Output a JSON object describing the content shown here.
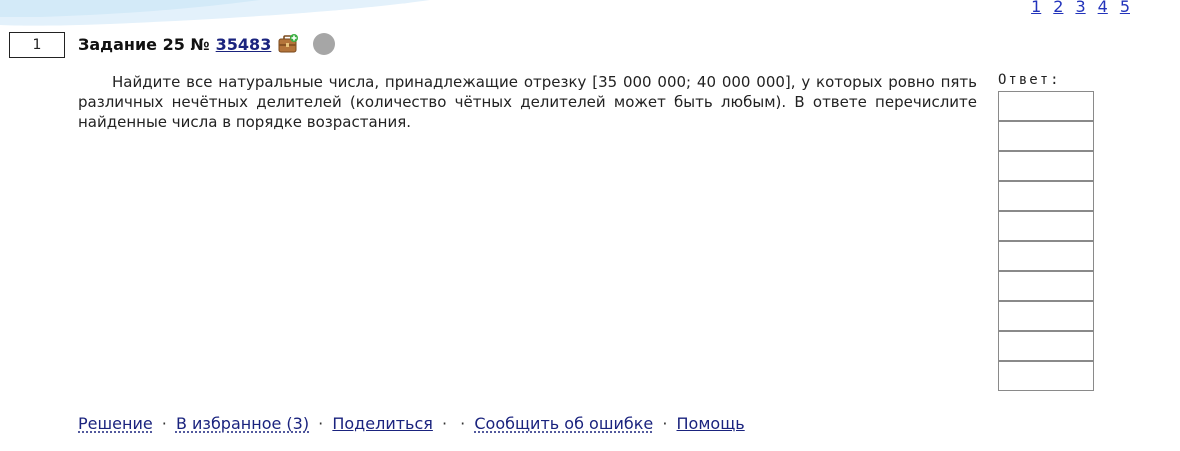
{
  "pagination": [
    "1",
    "2",
    "3",
    "4",
    "5"
  ],
  "task": {
    "number_box": "1",
    "label": "Задание 25 №",
    "id": "35483",
    "text": "Найдите все натуральные числа, принадлежащие отрезку [35 000 000; 40 000 000], у которых ровно пять различных нечётных делителей (количество чётных делителей может быть любым). В ответе перечислите найденные числа в порядке возрастания."
  },
  "answer": {
    "label": "Ответ:",
    "fields": [
      "",
      "",
      "",
      "",
      "",
      "",
      "",
      "",
      "",
      ""
    ]
  },
  "actions": {
    "solution": "Решение",
    "favorites": "В избранное (3)",
    "share": "Поделиться",
    "report_error": "Сообщить об ошибке",
    "help": "Помощь",
    "sep": "·"
  },
  "icons": {
    "briefcase": "briefcase-add-icon",
    "status": "status-circle-icon"
  },
  "colors": {
    "link": "#1a237e",
    "pagination_link": "#2233bb",
    "status_dot": "#a6a6a6",
    "swoosh": "#dff0fb"
  }
}
